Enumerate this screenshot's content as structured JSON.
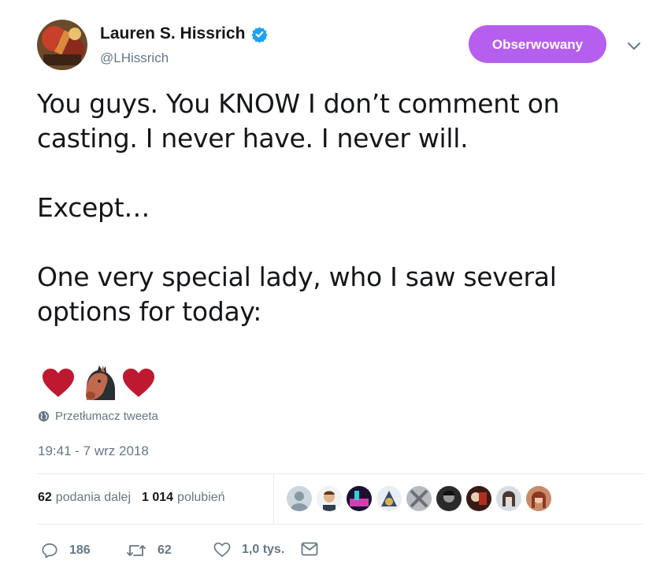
{
  "author": {
    "name": "Lauren S. Hissrich",
    "handle": "@LHissrich",
    "verified": true
  },
  "follow_button": {
    "label": "Obserwowany",
    "color": "#b65fee"
  },
  "tweet": {
    "lines": [
      "You guys. You KNOW I don’t comment on",
      "casting. I never have. I never will.",
      "Except…",
      "One very special lady, who I saw several",
      "options for today:"
    ],
    "emojis": [
      "heart-emoji",
      "horse-face-emoji",
      "heart-emoji"
    ]
  },
  "translate_label": "Przetłumacz tweeta",
  "timestamp": "19:41 - 7 wrz 2018",
  "stats": {
    "retweets_count": "62",
    "retweets_label": "podania dalej",
    "likes_count": "1 014",
    "likes_label": "polubień"
  },
  "actions": {
    "reply_count": "186",
    "retweet_count": "62",
    "like_count": "1,0 tys."
  },
  "icons": {
    "verified": "verified-badge-icon",
    "caret": "chevron-down-icon",
    "globe": "globe-icon",
    "reply": "reply-icon",
    "retweet": "retweet-icon",
    "like": "heart-icon",
    "dm": "envelope-icon"
  },
  "colors": {
    "text": "#14171a",
    "secondary": "#657786",
    "verified_blue": "#1da1f2",
    "heart_red": "#be1931"
  }
}
